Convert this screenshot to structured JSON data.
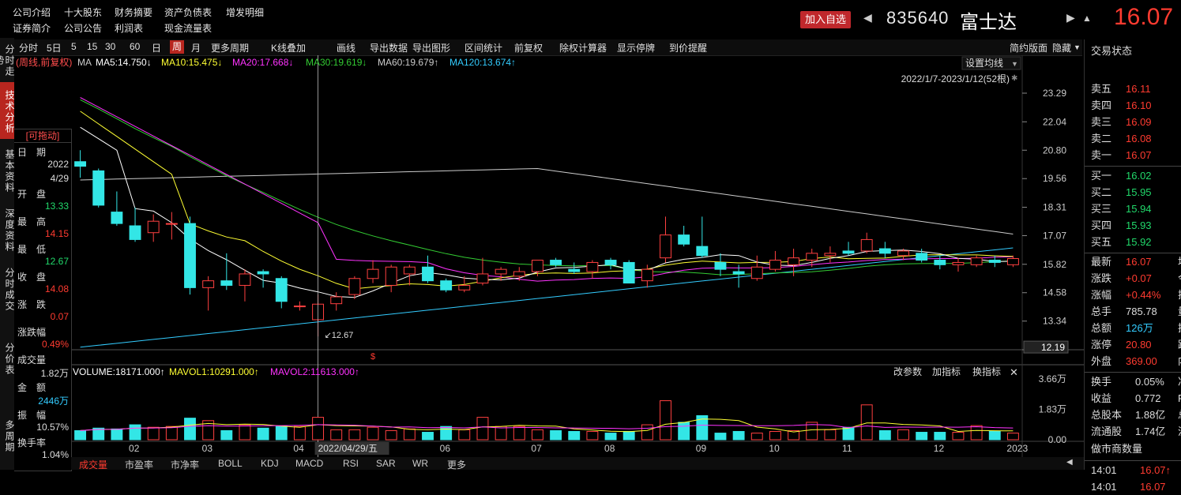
{
  "top_menu": {
    "row1": [
      "公司介绍",
      "十大股东",
      "财务摘要",
      "资产负债表",
      "增发明细"
    ],
    "row2": [
      "证券简介",
      "公司公告",
      "利润表",
      "现金流量表"
    ]
  },
  "stock": {
    "add_label": "加入自选",
    "code": "835640",
    "name": "富士达",
    "price": "16.07"
  },
  "left_tabs": [
    "分时走势",
    "技术分析",
    "基本资料",
    "深度资料",
    "分时成交",
    "分价表",
    "多周期"
  ],
  "toolbar": {
    "items": [
      "分时",
      "5日",
      "5",
      "15",
      "30",
      "60",
      "日",
      "周",
      "月",
      "更多周期",
      "K线叠加",
      "画线",
      "导出数据",
      "导出图形",
      "区间统计",
      "前复权",
      "除权计算器",
      "显示停牌",
      "到价提醒"
    ],
    "active": "周",
    "right": [
      "简约版面",
      "隐藏"
    ]
  },
  "ma_legend": {
    "prefix": "(周线,前复权)",
    "ma": "MA",
    "items": [
      {
        "label": "MA5:14.750↓",
        "color": "#ffffff"
      },
      {
        "label": "MA10:15.475↓",
        "color": "#ffff33"
      },
      {
        "label": "MA20:17.668↓",
        "color": "#ff33ff"
      },
      {
        "label": "MA30:19.619↓",
        "color": "#33cc33"
      },
      {
        "label": "MA60:19.679↑",
        "color": "#cccccc"
      },
      {
        "label": "MA120:13.674↑",
        "color": "#33ccff"
      }
    ],
    "settings": "设置均线",
    "range": "2022/1/7-2023/1/12(52根)"
  },
  "vol_legend": {
    "items": [
      {
        "label": "VOLUME:18171.000↑",
        "color": "#ffffff"
      },
      {
        "label": "MAVOL1:10291.000↑",
        "color": "#ffff33"
      },
      {
        "label": "MAVOL2:11613.000↑",
        "color": "#ff33ff"
      }
    ],
    "buttons": [
      "改参数",
      "加指标",
      "换指标"
    ]
  },
  "chart_data": {
    "type": "candlestick",
    "price_axis": {
      "ticks": [
        "23.29",
        "22.04",
        "20.80",
        "19.56",
        "18.31",
        "17.07",
        "15.82",
        "14.58",
        "13.34",
        "12.09"
      ],
      "min": 12.09,
      "max": 23.29,
      "marker": "12.19"
    },
    "volume_axis": {
      "ticks": [
        "3.66万",
        "1.83万",
        "0.00"
      ],
      "max": 3.66
    },
    "x_labels": [
      "02",
      "03",
      "04",
      "05",
      "06",
      "07",
      "08",
      "09",
      "10",
      "11",
      "12",
      "2023"
    ],
    "cursor_label": "2022/04/29/五",
    "low_annotation": "12.67",
    "candles": [
      {
        "o": 20.3,
        "h": 20.8,
        "l": 19.6,
        "c": 20.1
      },
      {
        "o": 19.9,
        "h": 20.0,
        "l": 18.3,
        "c": 18.4
      },
      {
        "o": 18.1,
        "h": 19.0,
        "l": 17.5,
        "c": 17.6
      },
      {
        "o": 17.5,
        "h": 18.3,
        "l": 16.8,
        "c": 16.9
      },
      {
        "o": 17.2,
        "h": 18.0,
        "l": 16.8,
        "c": 17.7
      },
      {
        "o": 17.6,
        "h": 18.1,
        "l": 16.9,
        "c": 17.6
      },
      {
        "o": 17.6,
        "h": 17.9,
        "l": 14.5,
        "c": 14.8
      },
      {
        "o": 14.8,
        "h": 15.3,
        "l": 13.8,
        "c": 15.1
      },
      {
        "o": 15.1,
        "h": 16.3,
        "l": 14.7,
        "c": 14.9
      },
      {
        "o": 14.9,
        "h": 15.6,
        "l": 14.2,
        "c": 15.4
      },
      {
        "o": 15.5,
        "h": 15.6,
        "l": 14.8,
        "c": 15.4
      },
      {
        "o": 15.2,
        "h": 15.3,
        "l": 13.9,
        "c": 14.2
      },
      {
        "o": 14.0,
        "h": 14.2,
        "l": 13.8,
        "c": 14.0
      },
      {
        "o": 13.4,
        "h": 14.5,
        "l": 12.67,
        "c": 14.08
      },
      {
        "o": 14.1,
        "h": 14.6,
        "l": 13.8,
        "c": 14.4
      },
      {
        "o": 14.5,
        "h": 15.3,
        "l": 14.3,
        "c": 15.2
      },
      {
        "o": 15.2,
        "h": 16.0,
        "l": 15.0,
        "c": 15.6
      },
      {
        "o": 14.9,
        "h": 15.8,
        "l": 14.6,
        "c": 15.7
      },
      {
        "o": 15.4,
        "h": 15.8,
        "l": 14.9,
        "c": 15.7
      },
      {
        "o": 15.7,
        "h": 16.2,
        "l": 15.0,
        "c": 15.1
      },
      {
        "o": 15.1,
        "h": 15.2,
        "l": 14.6,
        "c": 14.7
      },
      {
        "o": 14.7,
        "h": 15.3,
        "l": 14.6,
        "c": 14.9
      },
      {
        "o": 15.0,
        "h": 16.1,
        "l": 14.9,
        "c": 15.4
      },
      {
        "o": 15.4,
        "h": 15.7,
        "l": 15.1,
        "c": 15.6
      },
      {
        "o": 15.3,
        "h": 15.7,
        "l": 15.1,
        "c": 15.5
      },
      {
        "o": 15.5,
        "h": 16.0,
        "l": 15.3,
        "c": 16.0
      },
      {
        "o": 16.0,
        "h": 16.1,
        "l": 15.7,
        "c": 15.8
      },
      {
        "o": 15.6,
        "h": 15.9,
        "l": 15.4,
        "c": 15.5
      },
      {
        "o": 15.5,
        "h": 16.0,
        "l": 15.2,
        "c": 15.9
      },
      {
        "o": 16.0,
        "h": 16.1,
        "l": 15.6,
        "c": 15.8
      },
      {
        "o": 15.9,
        "h": 16.0,
        "l": 15.0,
        "c": 15.0
      },
      {
        "o": 15.1,
        "h": 15.8,
        "l": 14.8,
        "c": 15.6
      },
      {
        "o": 16.1,
        "h": 17.9,
        "l": 15.9,
        "c": 17.1
      },
      {
        "o": 17.1,
        "h": 17.5,
        "l": 16.6,
        "c": 16.7
      },
      {
        "o": 16.6,
        "h": 17.9,
        "l": 16.1,
        "c": 16.2
      },
      {
        "o": 15.9,
        "h": 16.3,
        "l": 15.3,
        "c": 15.6
      },
      {
        "o": 15.5,
        "h": 15.8,
        "l": 14.8,
        "c": 15.4
      },
      {
        "o": 15.2,
        "h": 16.2,
        "l": 15.1,
        "c": 15.7
      },
      {
        "o": 15.6,
        "h": 16.4,
        "l": 15.5,
        "c": 16.0
      },
      {
        "o": 15.8,
        "h": 16.5,
        "l": 15.3,
        "c": 16.1
      },
      {
        "o": 16.0,
        "h": 16.5,
        "l": 15.7,
        "c": 16.3
      },
      {
        "o": 16.2,
        "h": 16.6,
        "l": 15.9,
        "c": 16.3
      },
      {
        "o": 16.4,
        "h": 16.8,
        "l": 16.2,
        "c": 16.3
      },
      {
        "o": 16.4,
        "h": 17.2,
        "l": 16.3,
        "c": 16.9
      },
      {
        "o": 16.5,
        "h": 16.8,
        "l": 16.1,
        "c": 16.3
      },
      {
        "o": 16.2,
        "h": 16.5,
        "l": 16.0,
        "c": 16.4
      },
      {
        "o": 16.3,
        "h": 16.5,
        "l": 15.9,
        "c": 16.0
      },
      {
        "o": 16.0,
        "h": 16.2,
        "l": 15.6,
        "c": 15.8
      },
      {
        "o": 15.8,
        "h": 16.1,
        "l": 15.5,
        "c": 15.9
      },
      {
        "o": 15.8,
        "h": 16.2,
        "l": 15.7,
        "c": 16.1
      },
      {
        "o": 16.0,
        "h": 16.2,
        "l": 15.7,
        "c": 15.9
      },
      {
        "o": 15.8,
        "h": 16.2,
        "l": 15.7,
        "c": 16.07
      }
    ],
    "volumes": [
      0.55,
      0.7,
      0.65,
      0.9,
      0.75,
      0.8,
      1.3,
      1.15,
      0.55,
      0.9,
      0.7,
      0.8,
      0.8,
      1.35,
      0.6,
      0.6,
      0.75,
      0.55,
      0.65,
      0.45,
      0.8,
      0.6,
      1.35,
      0.8,
      0.8,
      0.6,
      0.55,
      0.5,
      0.5,
      0.4,
      0.5,
      0.9,
      2.35,
      1.05,
      1.45,
      0.4,
      0.5,
      0.4,
      0.5,
      0.55,
      1.05,
      0.6,
      0.75,
      2.1,
      0.55,
      0.6,
      0.45,
      0.45,
      0.45,
      0.85,
      0.5,
      0.4
    ]
  },
  "info_panel": {
    "draggable": "[可拖动]",
    "rows": [
      {
        "label": "日　期",
        "value": "2022",
        "color": "#dddddd"
      },
      {
        "label": "",
        "value": "4/29",
        "color": "#dddddd"
      },
      {
        "label": "开　盘",
        "value": "13.33",
        "color": "#21d96b"
      },
      {
        "label": "最　高",
        "value": "14.15",
        "color": "#ff3b30"
      },
      {
        "label": "最　低",
        "value": "12.67",
        "color": "#21d96b"
      },
      {
        "label": "收　盘",
        "value": "14.08",
        "color": "#ff3b30"
      },
      {
        "label": "涨　跌",
        "value": "0.07",
        "color": "#ff3b30"
      },
      {
        "label": "涨跌幅",
        "value": "0.49%",
        "color": "#ff3b30"
      },
      {
        "label": "成交量",
        "value": "1.82万",
        "color": "#dddddd"
      },
      {
        "label": "金　额",
        "value": "2446万",
        "color": "#33ccff"
      },
      {
        "label": "振　幅",
        "value": "10.57%",
        "color": "#dddddd"
      },
      {
        "label": "换手率",
        "value": "1.04%",
        "color": "#dddddd"
      }
    ]
  },
  "right_panel": {
    "title": "交易状态",
    "sells": [
      [
        "卖五",
        "16.11"
      ],
      [
        "卖四",
        "16.10"
      ],
      [
        "卖三",
        "16.09"
      ],
      [
        "卖二",
        "16.08"
      ],
      [
        "卖一",
        "16.07"
      ]
    ],
    "buys": [
      [
        "买一",
        "16.02"
      ],
      [
        "买二",
        "15.95"
      ],
      [
        "买三",
        "15.94"
      ],
      [
        "买四",
        "15.93"
      ],
      [
        "买五",
        "15.92"
      ]
    ],
    "stats": [
      {
        "l": "最新",
        "v": "16.07",
        "c": "r",
        "x": "均"
      },
      {
        "l": "涨跌",
        "v": "+0.07",
        "c": "r",
        "x": "今"
      },
      {
        "l": "涨幅",
        "v": "+0.44%",
        "c": "r",
        "x": "振"
      },
      {
        "l": "总手",
        "v": "785.78",
        "c": "w",
        "x": "量"
      },
      {
        "l": "总额",
        "v": "126万",
        "c": "b",
        "x": "换"
      },
      {
        "l": "涨停",
        "v": "20.80",
        "c": "r",
        "x": "跌"
      },
      {
        "l": "外盘",
        "v": "369.00",
        "c": "r",
        "x": "内"
      }
    ],
    "stats2": [
      {
        "l": "换手",
        "v": "0.05%",
        "c": "w",
        "x": "净"
      },
      {
        "l": "收益",
        "v": "0.772",
        "c": "w",
        "x": "P"
      },
      {
        "l": "总股本",
        "v": "1.88亿",
        "c": "w",
        "x": "总"
      },
      {
        "l": "流通股",
        "v": "1.74亿",
        "c": "w",
        "x": "流"
      }
    ],
    "market_maker": "做市商数量",
    "ticks": [
      [
        "14:01",
        "16.07↑"
      ],
      [
        "14:01",
        "16.07"
      ]
    ]
  },
  "bottom_tabs": {
    "items": [
      "成交量",
      "市盈率",
      "市净率",
      "BOLL",
      "KDJ",
      "MACD",
      "RSI",
      "SAR",
      "WR",
      "更多"
    ],
    "active": "成交量"
  }
}
